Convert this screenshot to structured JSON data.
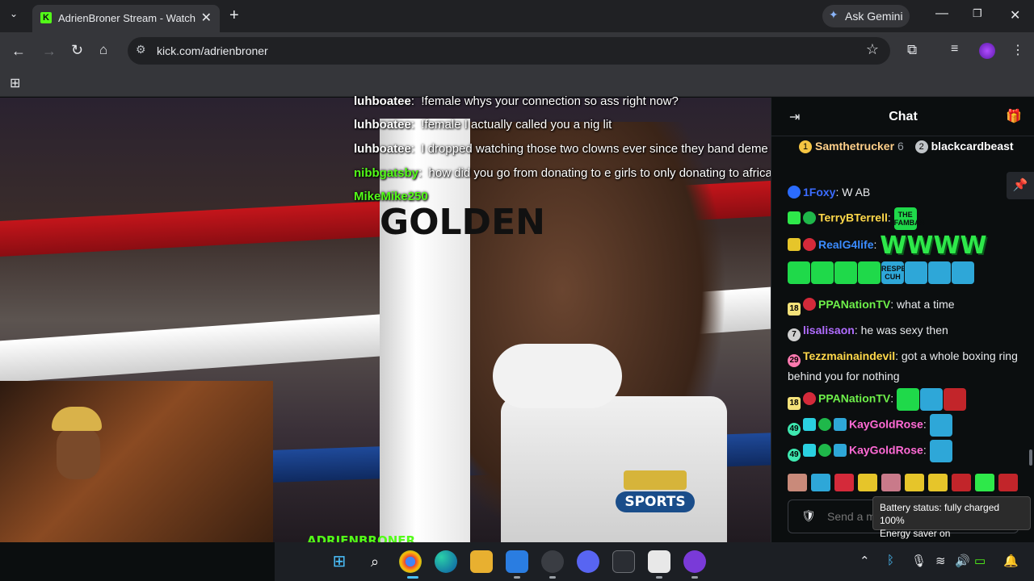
{
  "browser": {
    "tab_title": "AdrienBroner Stream - Watch L",
    "tab_favicon": "K",
    "new_tab": "+",
    "gemini_label": "Ask Gemini",
    "url": "kick.com/adrienbroner",
    "icons": [
      "tab-search-icon",
      "back-icon",
      "forward-icon",
      "reload-icon",
      "home-icon",
      "site-info-icon",
      "bookmark-star-icon",
      "extensions-icon",
      "media-icon",
      "profile-icon",
      "menu-icon",
      "apps-icon",
      "minimize-icon",
      "maximize-icon",
      "close-icon"
    ]
  },
  "stream": {
    "watermark": "ADRIENBRONER",
    "post_text": "GOLDEN",
    "hbo_label": "SPORTS",
    "overlay_chat": [
      {
        "user": "luhboatee",
        "text": "!female whys your connection so ass right now?"
      },
      {
        "user": "luhboatee",
        "text": "!female I actually called you a nig lit"
      },
      {
        "user": "luhboatee",
        "text": "I dropped watching those two clowns ever since they band deme"
      },
      {
        "user": "nibbgatsby",
        "text": "how did you go from donating to e girls to only donating to african men thats kinda gay"
      },
      {
        "user": "MikeMike250",
        "text": ""
      }
    ]
  },
  "chat": {
    "title": "Chat",
    "gifters": [
      {
        "rank": "1",
        "name": "Samthetrucker",
        "count": "6"
      },
      {
        "rank": "2",
        "name": "blackcardbeast",
        "count": ""
      }
    ],
    "messages": [
      {
        "user": "1Foxy",
        "text": "W AB",
        "color": "#3b6cff"
      },
      {
        "user": "TerryBTerrell",
        "text": "",
        "color": "#ffd84a"
      },
      {
        "user": "RealG4life",
        "text": "",
        "color": "#3b8cff"
      },
      {
        "user": "PPANationTV",
        "text": "what a time",
        "color": "#6ef04a",
        "badge": "18"
      },
      {
        "user": "lisalisaon",
        "text": "he was sexy then",
        "color": "#b06cff",
        "badge": "7"
      },
      {
        "user": "Tezzmainaindevil",
        "text": "got a whole boxing ring behind you for nothing",
        "color": "#ffd84a",
        "badge": "29"
      },
      {
        "user": "PPANationTV",
        "text": "",
        "color": "#6ef04a",
        "badge": "18"
      },
      {
        "user": "KayGoldRose",
        "text": "",
        "color": "#ff6ad5",
        "badge": "49"
      },
      {
        "user": "KayGoldRose",
        "text": "",
        "color": "#ff6ad5",
        "badge": "49"
      }
    ],
    "w_letters": [
      "W",
      "W",
      "W",
      "W"
    ],
    "emote_text": "THE FAMBAS",
    "respect_text": "RESPECT CUH",
    "input_placeholder": "Send a m"
  },
  "tooltip": {
    "line1": "Battery status: fully charged 100%",
    "line2": "Energy saver on"
  },
  "taskbar": {
    "apps": [
      "start",
      "search",
      "chrome",
      "edge",
      "file-explorer",
      "store",
      "snipping",
      "discord",
      "terminal",
      "slack",
      "app"
    ]
  },
  "colors": {
    "kick_green": "#53fc18",
    "chat_bg": "#0b0e0f",
    "chrome_dark": "#202124",
    "chrome_mid": "#35363a"
  }
}
